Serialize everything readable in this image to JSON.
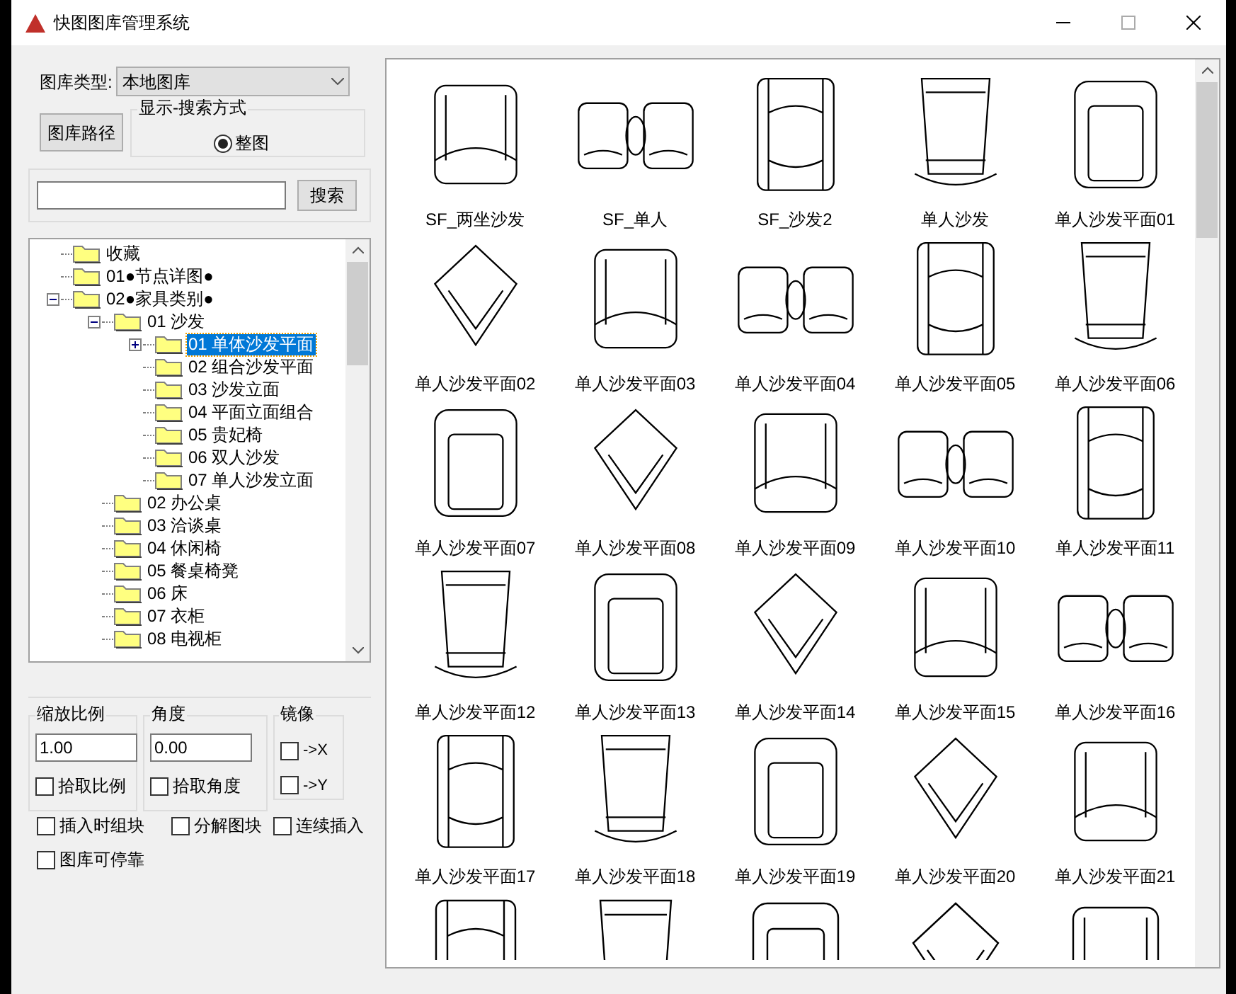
{
  "window": {
    "title": "快图图库管理系统"
  },
  "library_type": {
    "label": "图库类型:",
    "value": "本地图库"
  },
  "path_button": "图库路径",
  "display_mode": {
    "legend": "显示-搜索方式",
    "options": [
      {
        "label": "整图",
        "selected": true
      }
    ]
  },
  "search_button": "搜索",
  "tree": [
    {
      "label": "收藏",
      "selected": false
    },
    {
      "label": "01●节点详图●",
      "selected": false
    },
    {
      "label": "02●家具类别●",
      "selected": false,
      "expanded": true,
      "children": [
        {
          "label": "01 沙发",
          "selected": false,
          "expanded": true,
          "children": [
            {
              "label": "01 单体沙发平面",
              "selected": true,
              "expanded": false
            },
            {
              "label": "02 组合沙发平面",
              "selected": false
            },
            {
              "label": "03 沙发立面",
              "selected": false
            },
            {
              "label": "04 平面立面组合",
              "selected": false
            },
            {
              "label": "05 贵妃椅",
              "selected": false
            },
            {
              "label": "06 双人沙发",
              "selected": false
            },
            {
              "label": "07 单人沙发立面",
              "selected": false
            }
          ]
        },
        {
          "label": "02 办公桌",
          "selected": false
        },
        {
          "label": "03 洽谈桌",
          "selected": false
        },
        {
          "label": "04 休闲椅",
          "selected": false
        },
        {
          "label": "05 餐桌椅凳",
          "selected": false
        },
        {
          "label": "06 床",
          "selected": false
        },
        {
          "label": "07 衣柜",
          "selected": false
        },
        {
          "label": "08 电视柜",
          "selected": false
        }
      ]
    }
  ],
  "scale": {
    "legend": "缩放比例",
    "value": "1.00",
    "pick": {
      "label": "拾取比例",
      "checked": false
    }
  },
  "angle": {
    "legend": "角度",
    "value": "0.00",
    "pick": {
      "label": "拾取角度",
      "checked": false
    }
  },
  "mirror": {
    "legend": "镜像",
    "options": [
      {
        "label": "->X",
        "checked": false
      },
      {
        "label": "->Y",
        "checked": false
      }
    ]
  },
  "options": [
    {
      "label": "插入时组块",
      "checked": false
    },
    {
      "label": "分解图块",
      "checked": false
    },
    {
      "label": "连续插入",
      "checked": false
    },
    {
      "label": "图库可停靠",
      "checked": false
    }
  ],
  "gallery": {
    "items": [
      {
        "label": "SF_两坐沙发"
      },
      {
        "label": "SF_单人"
      },
      {
        "label": "SF_沙发2"
      },
      {
        "label": "单人沙发"
      },
      {
        "label": "单人沙发平面01"
      },
      {
        "label": "单人沙发平面02"
      },
      {
        "label": "单人沙发平面03"
      },
      {
        "label": "单人沙发平面04"
      },
      {
        "label": "单人沙发平面05"
      },
      {
        "label": "单人沙发平面06"
      },
      {
        "label": "单人沙发平面07"
      },
      {
        "label": "单人沙发平面08"
      },
      {
        "label": "单人沙发平面09"
      },
      {
        "label": "单人沙发平面10"
      },
      {
        "label": "单人沙发平面11"
      },
      {
        "label": "单人沙发平面12"
      },
      {
        "label": "单人沙发平面13"
      },
      {
        "label": "单人沙发平面14"
      },
      {
        "label": "单人沙发平面15"
      },
      {
        "label": "单人沙发平面16"
      },
      {
        "label": "单人沙发平面17"
      },
      {
        "label": "单人沙发平面18"
      },
      {
        "label": "单人沙发平面19"
      },
      {
        "label": "单人沙发平面20"
      },
      {
        "label": "单人沙发平面21"
      }
    ]
  }
}
